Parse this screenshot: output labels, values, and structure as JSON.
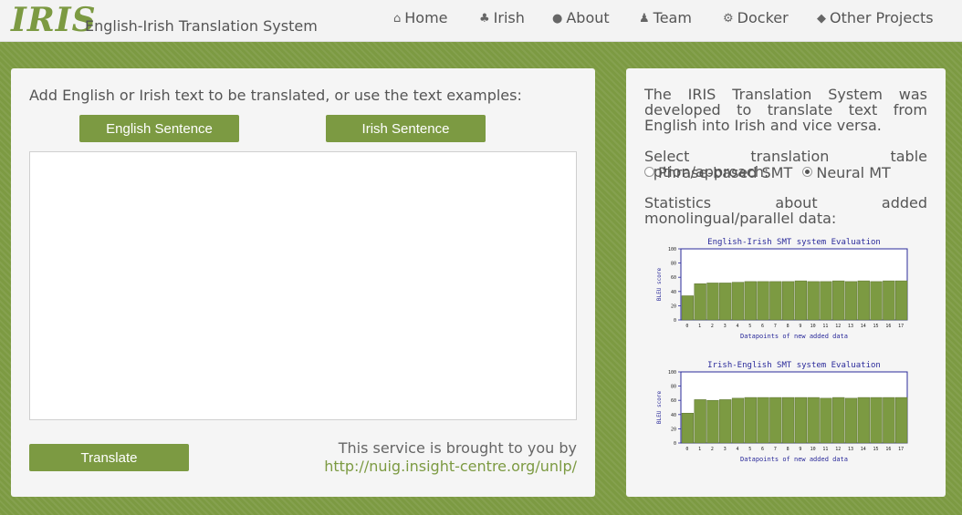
{
  "brand": {
    "logo": "IRIS",
    "subtitle": "English-Irish Translation System"
  },
  "nav": [
    {
      "label": "Home",
      "icon": "home-icon",
      "glyph": "⌂"
    },
    {
      "label": "Irish",
      "icon": "shamrock-icon",
      "glyph": "♣"
    },
    {
      "label": "About",
      "icon": "comment-icon",
      "glyph": "●"
    },
    {
      "label": "Team",
      "icon": "users-icon",
      "glyph": "♟"
    },
    {
      "label": "Docker",
      "icon": "cogs-icon",
      "glyph": "⚙"
    },
    {
      "label": "Other Projects",
      "icon": "tags-icon",
      "glyph": "◆"
    }
  ],
  "main": {
    "instruction": "Add English or Irish text to be translated, or use the text examples:",
    "english_button": "English Sentence",
    "irish_button": "Irish Sentence",
    "input_value": "",
    "translate_button": "Translate",
    "credit_text": "This service is brought to you by",
    "credit_link": "http://nuig.insight-centre.org/unlp/"
  },
  "side": {
    "intro": "The IRIS Translation System was developed to translate text from English into Irish and vice versa.",
    "select_label": "Select translation table option/approach:",
    "option_smt": "Phrase-based SMT",
    "option_nmt": "Neural MT",
    "selected_option": "Neural MT",
    "stats_label": "Statistics about added monolingual/parallel data:"
  },
  "colors": {
    "accent": "#7c9a42",
    "chart_axis": "#2a2a9a"
  },
  "chart_data": [
    {
      "type": "bar",
      "title": "English-Irish SMT system Evaluation",
      "xlabel": "Datapoints of new added data",
      "ylabel": "BLEU score",
      "categories": [
        "0",
        "1",
        "2",
        "3",
        "4",
        "5",
        "6",
        "7",
        "8",
        "9",
        "10",
        "11",
        "12",
        "13",
        "14",
        "15",
        "16",
        "17"
      ],
      "values": [
        34,
        51,
        52,
        52,
        53,
        54,
        54,
        54,
        54,
        55,
        54,
        54,
        55,
        54,
        55,
        54,
        55,
        55
      ],
      "ylim": [
        0,
        100
      ],
      "yticks": [
        "0",
        "20",
        "40",
        "60",
        "80",
        "100"
      ]
    },
    {
      "type": "bar",
      "title": "Irish-English SMT system Evaluation",
      "xlabel": "Datapoints of new added data",
      "ylabel": "BLEU score",
      "categories": [
        "0",
        "1",
        "2",
        "3",
        "4",
        "5",
        "6",
        "7",
        "8",
        "9",
        "10",
        "11",
        "12",
        "13",
        "14",
        "15",
        "16",
        "17"
      ],
      "values": [
        42,
        61,
        60,
        61,
        63,
        64,
        64,
        64,
        64,
        64,
        64,
        63,
        64,
        63,
        64,
        64,
        64,
        64
      ],
      "ylim": [
        0,
        100
      ],
      "yticks": [
        "0",
        "20",
        "40",
        "60",
        "80",
        "100"
      ]
    }
  ]
}
